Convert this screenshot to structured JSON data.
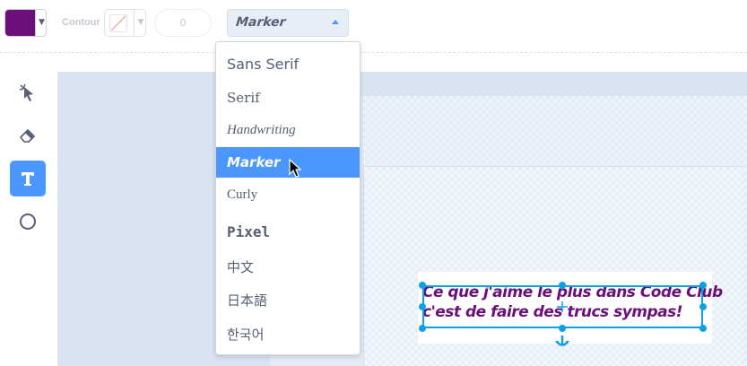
{
  "toolbar": {
    "fill_color": "#6b0f79",
    "outline_label": "Contour",
    "outline_width_value": "0",
    "font_selected": "Marker"
  },
  "font_menu": {
    "items": [
      {
        "label": "Sans Serif"
      },
      {
        "label": "Serif"
      },
      {
        "label": "Handwriting"
      },
      {
        "label": "Marker"
      },
      {
        "label": "Curly"
      },
      {
        "label": "Pixel"
      },
      {
        "label": "中文"
      },
      {
        "label": "日本語"
      },
      {
        "label": "한국어"
      }
    ],
    "selected_index": 3
  },
  "tools": [
    {
      "icon": "reshape-icon",
      "active": false
    },
    {
      "icon": "eraser-icon",
      "active": false
    },
    {
      "icon": "text-icon",
      "active": true
    },
    {
      "icon": "circle-icon",
      "active": false
    }
  ],
  "canvas": {
    "text_lines": [
      "Ce que j'aime le plus dans Code Club",
      " c'est de faire des trucs sympas!"
    ],
    "text_color": "#6b0f79",
    "selection_color": "#0ea1e6"
  },
  "colors": {
    "accent": "#4c97ff",
    "text_gray": "#575e75"
  }
}
